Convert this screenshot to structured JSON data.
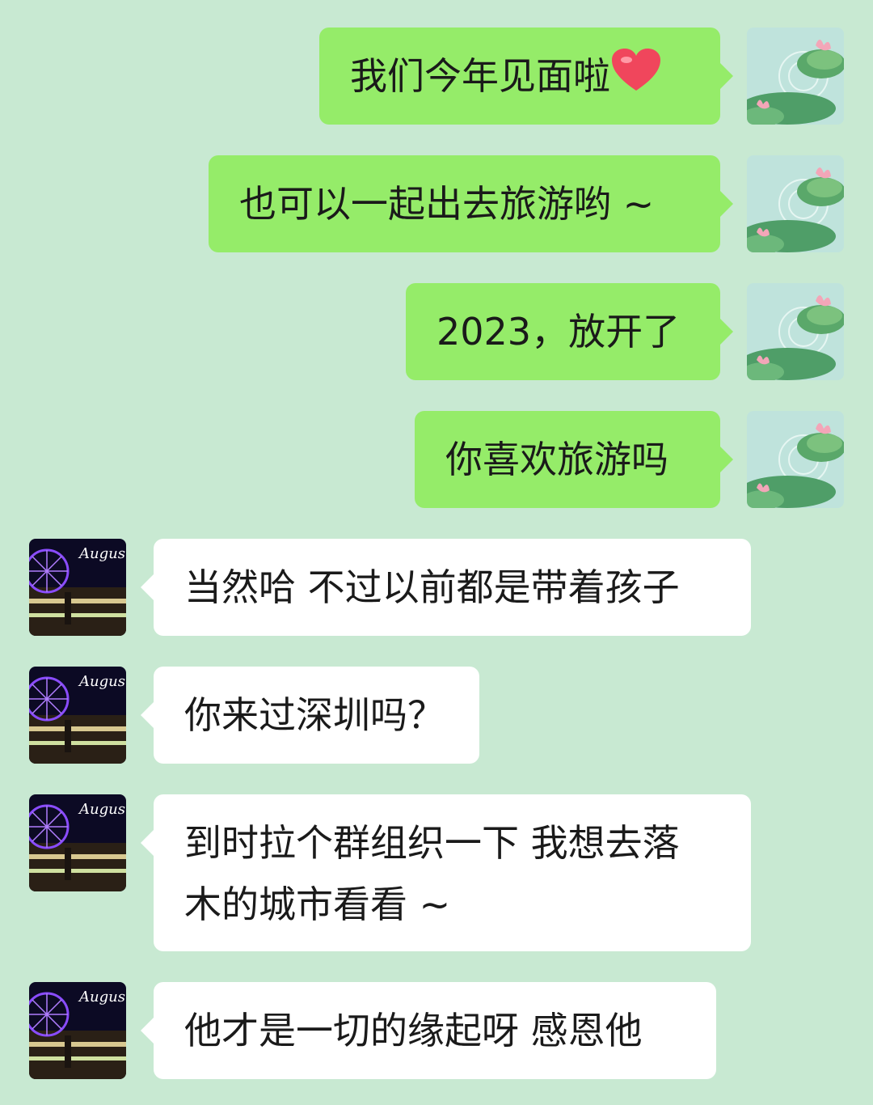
{
  "messages": [
    {
      "side": "self",
      "text": "我们今年见面啦",
      "emoji": "heart-emoji"
    },
    {
      "side": "self",
      "text": "也可以一起出去旅游哟 ~"
    },
    {
      "side": "self",
      "text": "2023，放开了"
    },
    {
      "side": "self",
      "text": "你喜欢旅游吗"
    },
    {
      "side": "other",
      "text": "当然哈 不过以前都是带着孩子"
    },
    {
      "side": "other",
      "text": "你来过深圳吗？"
    },
    {
      "side": "other",
      "line1": "到时拉个群组织一下 我想去落",
      "line2": "木的城市看看 ~"
    },
    {
      "side": "other",
      "text": "他才是一切的缘起呀 感恩他"
    }
  ],
  "other_avatar": {
    "text": "August",
    "icon": "ferris-wheel-night-photo"
  },
  "self_avatar": {
    "icon": "lotus-pond-illustration"
  },
  "colors": {
    "background": "#c8e9d2",
    "outgoing_bubble": "#95ec69",
    "incoming_bubble": "#ffffff"
  }
}
